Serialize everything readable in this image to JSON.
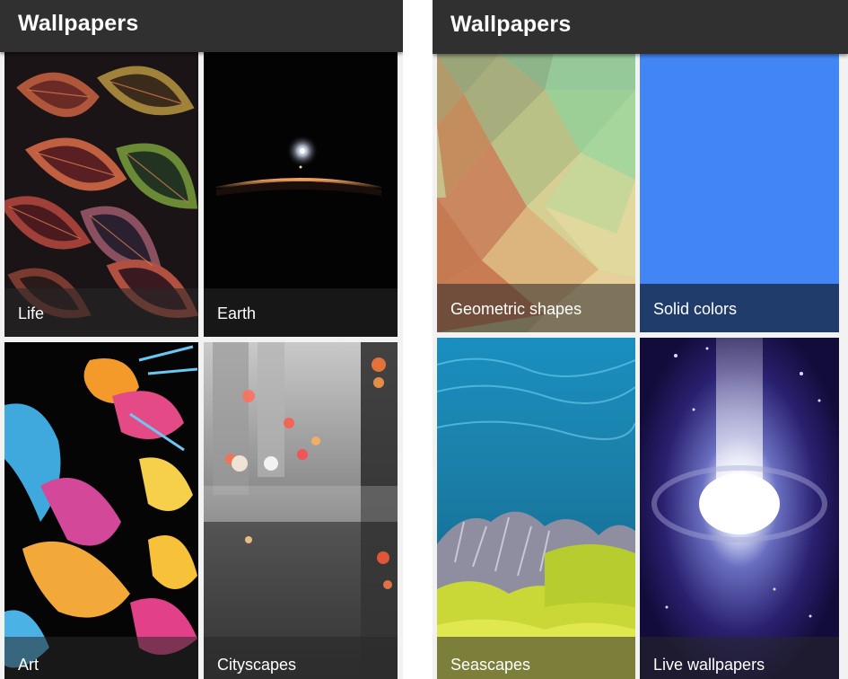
{
  "screens": [
    {
      "title": "Wallpapers",
      "categories": [
        {
          "label": "Life"
        },
        {
          "label": "Earth"
        },
        {
          "label": "Art"
        },
        {
          "label": "Cityscapes"
        }
      ]
    },
    {
      "title": "Wallpapers",
      "categories": [
        {
          "label": "Geometric shapes"
        },
        {
          "label": "Solid colors",
          "color": "#4285f4"
        },
        {
          "label": "Seascapes"
        },
        {
          "label": "Live wallpapers"
        }
      ]
    }
  ],
  "colors": {
    "appbar": "#303030",
    "background": "#f2f2f2"
  }
}
